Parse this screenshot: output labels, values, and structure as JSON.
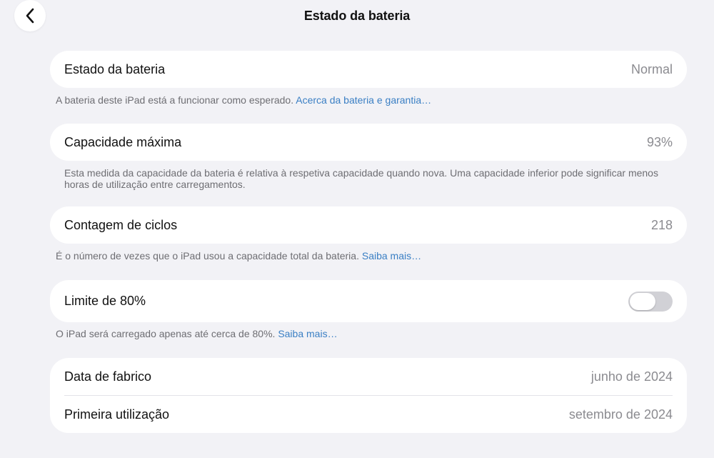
{
  "header": {
    "title": "Estado da bateria",
    "back_icon": "chevron-left-icon"
  },
  "battery_state": {
    "label": "Estado da bateria",
    "value": "Normal",
    "note": "A bateria deste iPad está a funcionar como esperado.",
    "link": "Acerca da bateria e garantia…"
  },
  "max_capacity": {
    "label": "Capacidade máxima",
    "value": "93%",
    "note": "Esta medida da capacidade da bateria é relativa à respetiva capacidade quando nova. Uma capacidade inferior pode significar menos horas de utilização entre carregamentos."
  },
  "cycle_count": {
    "label": "Contagem de ciclos",
    "value": "218",
    "note": "É o número de vezes que o iPad usou a capacidade total da bateria.",
    "link": "Saiba mais…"
  },
  "limit_80": {
    "label": "Limite de 80%",
    "enabled": false,
    "note": "O iPad será carregado apenas até cerca de 80%.",
    "link": "Saiba mais…"
  },
  "dates": {
    "manufacture_label": "Data de fabrico",
    "manufacture_value": "junho de 2024",
    "first_use_label": "Primeira utilização",
    "first_use_value": "setembro de 2024"
  },
  "colors": {
    "background": "#f2f2f6",
    "card": "#ffffff",
    "link": "#3a7fc4",
    "secondary_text": "#8b8b90",
    "toggle_off": "#d1d1d6"
  }
}
